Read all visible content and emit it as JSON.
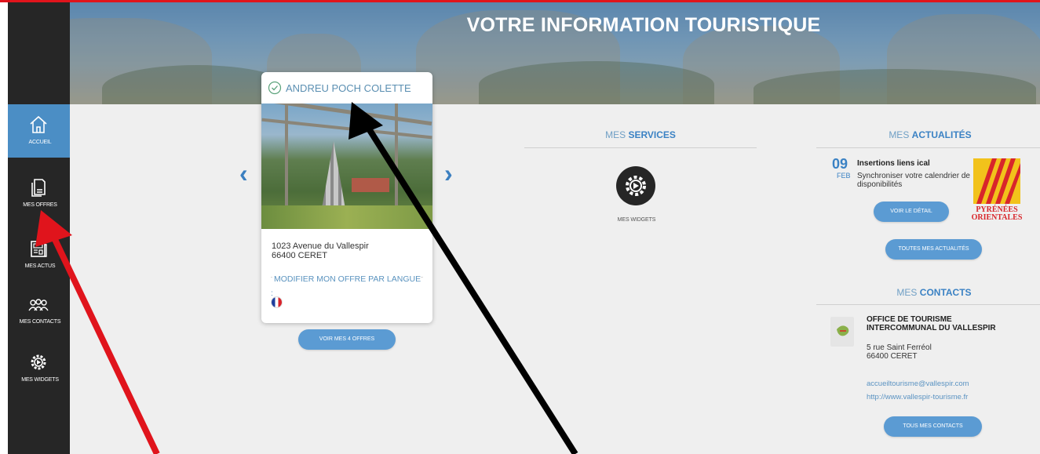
{
  "hero": {
    "title": "VOTRE INFORMATION TOURISTIQUE"
  },
  "sidebar": {
    "items": [
      {
        "label": "ACCUEIL",
        "icon": "home-icon",
        "active": true
      },
      {
        "label": "MES OFFRES",
        "icon": "offers-icon"
      },
      {
        "label": "MES ACTUS",
        "icon": "news-icon"
      },
      {
        "label": "MES CONTACTS",
        "icon": "contacts-icon"
      },
      {
        "label": "MES WIDGETS",
        "icon": "widget-gear-icon"
      }
    ]
  },
  "offer": {
    "name": "ANDREU POCH COLETTE",
    "address_line1": "1023 Avenue du Vallespir",
    "address_line2": "66400 CERET",
    "lang_label": "MODIFIER MON OFFRE PAR LANGUE :",
    "lang_flag": "french-flag-icon",
    "see_all_button": "VOIR MES 4 OFFRES"
  },
  "services": {
    "title_prefix": "MES",
    "title_main": "SERVICES",
    "widget_label": "MES WIDGETS"
  },
  "news": {
    "title_prefix": "MES",
    "title_main": "ACTUALITÉS",
    "day": "09",
    "month": "FEB",
    "item_title": "Insertions liens ical",
    "item_text": "Synchroniser votre calendrier de disponibilités",
    "detail_button": "VOIR LE DÉTAIL",
    "all_button": "TOUTES MES ACTUALITÉS",
    "logo_text_1": "PYRÉNÉES",
    "logo_text_2": "ORIENTALES"
  },
  "contacts": {
    "title_prefix": "MES",
    "title_main": "CONTACTS",
    "name": "OFFICE DE TOURISME INTERCOMMUNAL DU VALLESPIR",
    "address_line1": "5 rue Saint Ferréol",
    "address_line2": "66400 CERET",
    "email": "accueiltourisme@vallespir.com",
    "website": "http://www.vallespir-tourisme.fr",
    "all_button": "TOUS MES CONTACTS"
  },
  "colors": {
    "accent": "#3b82c4",
    "button": "#5b9bd3",
    "sidebar": "#262626",
    "annotation_red": "#e0141c",
    "annotation_black": "#000000"
  }
}
